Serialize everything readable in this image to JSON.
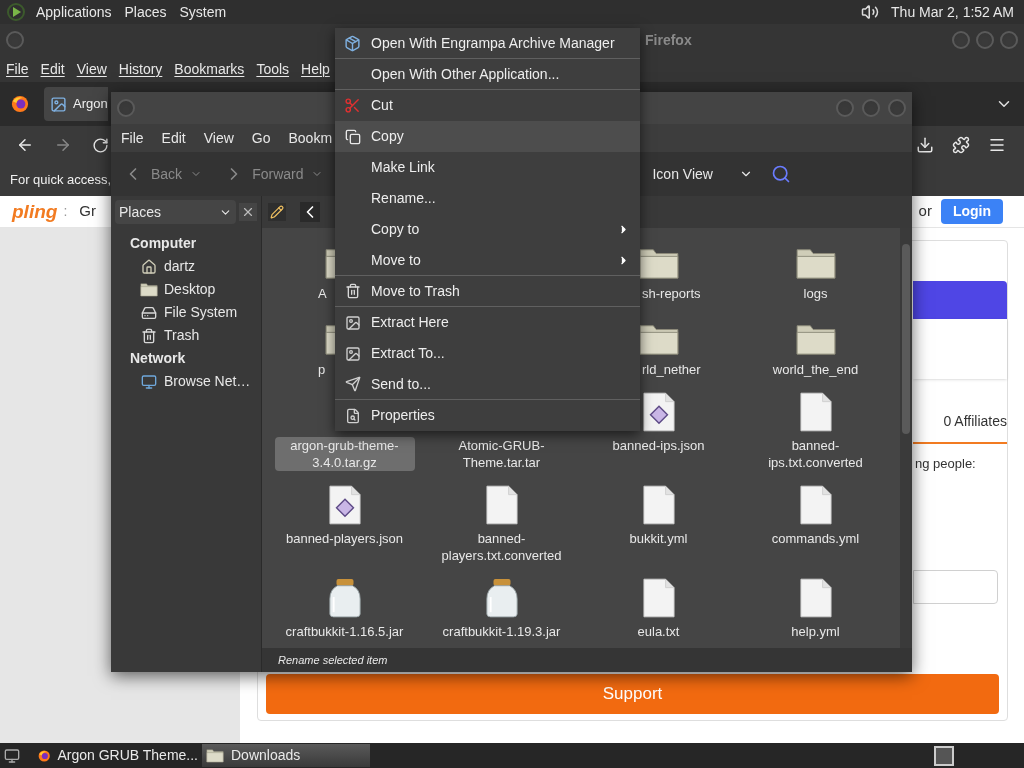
{
  "top_panel": {
    "menus": [
      "Applications",
      "Places",
      "System"
    ],
    "clock": "Thu Mar 2, 1:52 AM"
  },
  "browser": {
    "title": "Firefox",
    "menu": [
      "File",
      "Edit",
      "View",
      "History",
      "Bookmarks",
      "Tools",
      "Help"
    ],
    "tab": {
      "title": "Argon",
      "selected": true
    },
    "bookmarks_hint": "For quick access,",
    "page": {
      "logo": "pling",
      "separator": ":",
      "heading": "Gr",
      "or": "or",
      "login": "Login",
      "affiliates": "0 Affiliates",
      "text": "ng people:",
      "support": "Support"
    }
  },
  "file_manager": {
    "menu": [
      "File",
      "Edit",
      "View",
      "Go",
      "Bookm"
    ],
    "toolbar": [
      {
        "label": "Back",
        "disabled": true
      },
      {
        "label": "Forward",
        "disabled": true
      }
    ],
    "view_mode": "Icon View",
    "side_pane": "Places",
    "sidebar": [
      {
        "heading": "Computer",
        "items": [
          {
            "label": "dartz",
            "kind": "home"
          },
          {
            "label": "Desktop",
            "kind": "desktop"
          },
          {
            "label": "File System",
            "kind": "drive"
          },
          {
            "label": "Trash",
            "kind": "trash"
          }
        ]
      },
      {
        "heading": "Network",
        "items": [
          {
            "label": "Browse Net…",
            "kind": "network"
          }
        ]
      }
    ],
    "items": [
      {
        "name": "A",
        "kind": "folder",
        "selected": false
      },
      {
        "kind": "hidden"
      },
      {
        "name": "sh-reports",
        "kind": "folder",
        "selected": false
      },
      {
        "name": "logs",
        "kind": "folder",
        "selected": false
      },
      {
        "name": "p",
        "kind": "folder",
        "selected": false
      },
      {
        "kind": "hidden"
      },
      {
        "name": "rld_nether",
        "kind": "folder",
        "selected": false
      },
      {
        "name": "world_the_end",
        "kind": "folder",
        "selected": false
      },
      {
        "name": "argon-grub-theme-3.4.0.tar.gz",
        "kind": "none",
        "selected": true
      },
      {
        "name": "Atomic-GRUB-Theme.tar.tar",
        "kind": "none",
        "selected": false
      },
      {
        "name": "banned-ips.json",
        "kind": "json",
        "selected": false
      },
      {
        "name": "banned-ips.txt.converted",
        "kind": "file",
        "selected": false
      },
      {
        "name": "banned-players.json",
        "kind": "json",
        "selected": false
      },
      {
        "name": "banned-players.txt.converted",
        "kind": "file",
        "selected": false
      },
      {
        "name": "bukkit.yml",
        "kind": "file",
        "selected": false
      },
      {
        "name": "commands.yml",
        "kind": "file",
        "selected": false
      },
      {
        "name": "craftbukkit-1.16.5.jar",
        "kind": "jar",
        "selected": false
      },
      {
        "name": "craftbukkit-1.19.3.jar",
        "kind": "jar",
        "selected": false
      },
      {
        "name": "eula.txt",
        "kind": "file",
        "selected": false
      },
      {
        "name": "help.yml",
        "kind": "file",
        "selected": false
      }
    ],
    "status": "Rename selected item"
  },
  "context_menu": [
    {
      "label": "Open With Engrampa Archive Manager",
      "kind": "archive",
      "selected": false,
      "submenu": false,
      "separator_after": true
    },
    {
      "label": "Open With Other Application...",
      "kind": "none",
      "selected": false,
      "submenu": false,
      "separator_after": true
    },
    {
      "label": "Cut",
      "kind": "scissors",
      "selected": false,
      "submenu": false,
      "separator_after": false
    },
    {
      "label": "Copy",
      "kind": "copy",
      "selected": true,
      "submenu": false,
      "separator_after": false
    },
    {
      "label": "Make Link",
      "kind": "none",
      "selected": false,
      "submenu": false,
      "separator_after": false
    },
    {
      "label": "Rename...",
      "kind": "none",
      "selected": false,
      "submenu": false,
      "separator_after": false
    },
    {
      "label": "Copy to",
      "kind": "none",
      "selected": false,
      "submenu": true,
      "separator_after": false
    },
    {
      "label": "Move to",
      "kind": "none",
      "selected": false,
      "submenu": true,
      "separator_after": true
    },
    {
      "label": "Move to Trash",
      "kind": "trash",
      "selected": false,
      "submenu": false,
      "separator_after": true
    },
    {
      "label": "Extract Here",
      "kind": "extract",
      "selected": false,
      "submenu": false,
      "separator_after": false
    },
    {
      "label": "Extract To...",
      "kind": "extract",
      "selected": false,
      "submenu": false,
      "separator_after": false
    },
    {
      "label": "Send to...",
      "kind": "send",
      "selected": false,
      "submenu": false,
      "separator_after": true
    },
    {
      "label": "Properties",
      "kind": "properties",
      "selected": false,
      "submenu": false,
      "separator_after": false
    }
  ],
  "taskbar": [
    {
      "label": "Argon GRUB Theme...",
      "kind": "browser",
      "selected": false
    },
    {
      "label": "Downloads",
      "kind": "folder",
      "selected": true
    }
  ]
}
